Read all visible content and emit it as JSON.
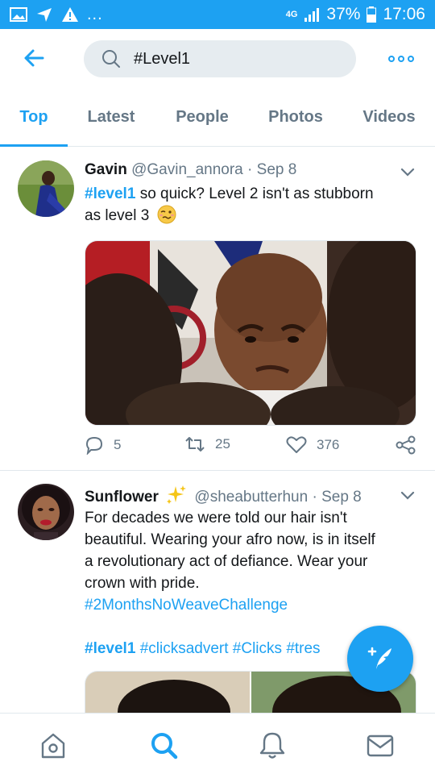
{
  "status_bar": {
    "network": "4G",
    "battery": "37%",
    "time": "17:06",
    "overflow": "...",
    "icons": [
      "image-icon",
      "send-icon",
      "warning-icon",
      "signal-icon",
      "battery-icon"
    ]
  },
  "search": {
    "query": "#Level1",
    "icons": [
      "back-arrow-icon",
      "search-icon",
      "more-icon"
    ]
  },
  "tabs": [
    {
      "label": "Top",
      "active": true
    },
    {
      "label": "Latest",
      "active": false
    },
    {
      "label": "People",
      "active": false
    },
    {
      "label": "Photos",
      "active": false
    },
    {
      "label": "Videos",
      "active": false
    }
  ],
  "tweets": [
    {
      "name": "Gavin",
      "handle": "@Gavin_annora",
      "sep": "·",
      "date": "Sep 8",
      "hashtag": "#level1",
      "text_1": "so quick? Level 2 isn't as stubborn",
      "text_2": "as level 3",
      "emoji": "woozy-face-emoji",
      "replies": "5",
      "retweets": "25",
      "likes": "376"
    },
    {
      "name": "Sunflower",
      "sparkle": "sparkles-emoji",
      "handle": "@sheabutterhun",
      "sep": "·",
      "date": "Sep 8",
      "line_1": "For decades we were told our hair isn't",
      "line_2": "beautiful. Wearing your afro now, is in itself",
      "line_3": "a revolutionary act of defiance. Wear your",
      "line_4": "crown with pride.",
      "hashtag_line": "#2MonthsNoWeaveChallenge",
      "tag_a": "#level1",
      "tag_b": "#clicksadvert",
      "tag_c": "#Clicks",
      "tag_d": "#tres"
    }
  ],
  "accent_color": "#1da1f2",
  "bottom_nav": [
    "home-icon",
    "search-icon",
    "notifications-icon",
    "messages-icon"
  ]
}
